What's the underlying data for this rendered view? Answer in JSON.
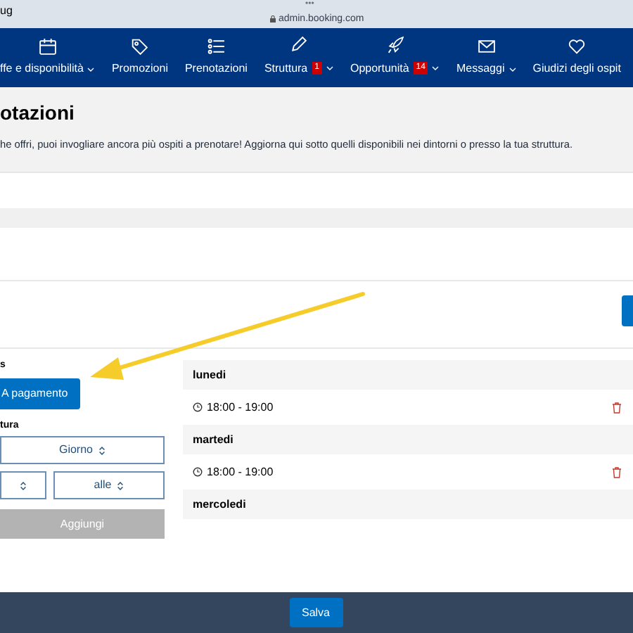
{
  "browser": {
    "status_left": "ug",
    "dots": "•••",
    "url": "admin.booking.com"
  },
  "nav": {
    "items": [
      {
        "label": "ffe e disponibilità",
        "has_menu": true
      },
      {
        "label": "Promozioni",
        "has_menu": false
      },
      {
        "label": "Prenotazioni",
        "has_menu": false
      },
      {
        "label": "Struttura",
        "badge": "1",
        "has_menu": true
      },
      {
        "label": "Opportunità",
        "badge": "14",
        "has_menu": true
      },
      {
        "label": "Messaggi",
        "has_menu": true
      },
      {
        "label": "Giudizi degli ospit",
        "has_menu": false
      }
    ]
  },
  "header": {
    "title": "otazioni",
    "description": "he offri, puoi invogliare ancora più ospiti a prenotare! Aggiorna qui sotto quelli disponibili nei dintorni o presso la tua struttura."
  },
  "form": {
    "label_1": "s",
    "price_button": "A pagamento",
    "label_2": "tura",
    "day_select": "Giorno",
    "to_select": "alle",
    "add_button": {
      "label": "Aggiungi",
      "disabled": true
    }
  },
  "schedule": {
    "days": [
      {
        "day": "lunedi",
        "slots": [
          "18:00 - 19:00"
        ]
      },
      {
        "day": "martedi",
        "slots": [
          "18:00 - 19:00"
        ]
      },
      {
        "day": "mercoledi"
      }
    ]
  },
  "footer": {
    "save_button": "Salva"
  }
}
